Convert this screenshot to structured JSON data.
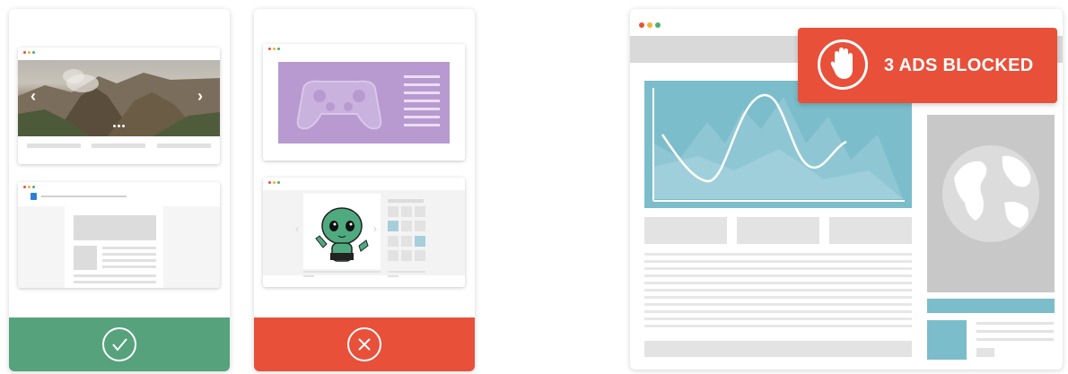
{
  "colors": {
    "accept": "#56a27c",
    "reject": "#e8503a",
    "chart_panel": "#7bbdca",
    "gamepad_panel": "#b89ad1",
    "highlight_tile": "#a6cfdc",
    "window_dot_red": "#e8503a",
    "window_dot_yellow": "#f2b233",
    "window_dot_green": "#4caf6e"
  },
  "acceptable_card": {
    "status_icon": "checkmark-circle-icon",
    "examples": [
      "image-carousel-ad",
      "text-article-ad"
    ]
  },
  "rejected_card": {
    "status_icon": "x-circle-icon",
    "examples": [
      "animated-gamepad-ad",
      "popup-character-ad"
    ]
  },
  "browser_mock": {
    "badge": {
      "icon": "stop-hand-icon",
      "text": "3 ADS BLOCKED"
    },
    "panels": [
      "line-chart",
      "globe-sidebar",
      "article-text"
    ]
  }
}
